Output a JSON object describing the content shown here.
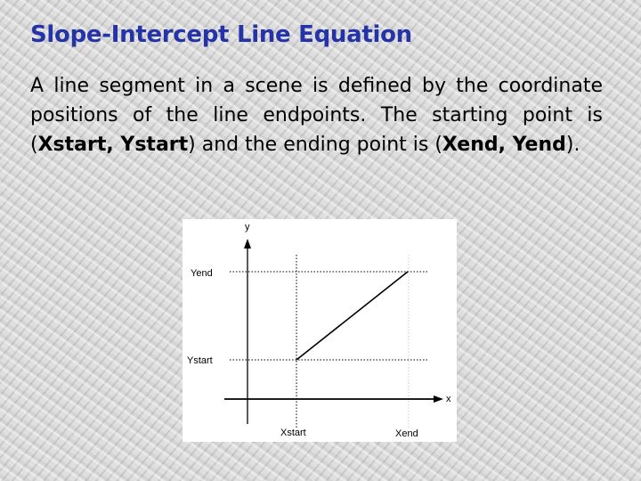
{
  "title": "Slope-Intercept Line Equation",
  "body": {
    "text1": "A line segment in a scene is defined by the coordinate positions of the line endpoints. The starting point is (",
    "start_point": "Xstart, Ystart",
    "text2": ") and the ending point is (",
    "end_point": "Xend, Yend",
    "text3": ")."
  },
  "diagram": {
    "y_axis_label": "y",
    "x_axis_label": "x",
    "y_end_label": "Yend",
    "y_start_label": "Ystart",
    "x_start_label": "Xstart",
    "x_end_label": "Xend"
  }
}
